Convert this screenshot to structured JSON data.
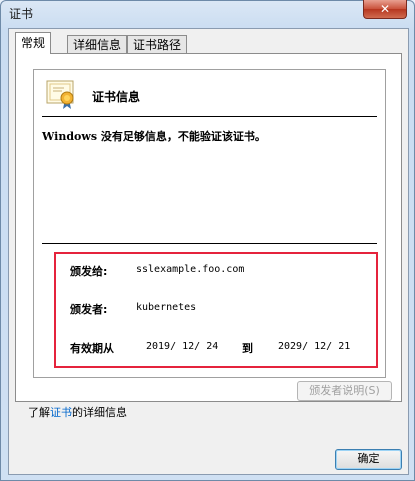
{
  "window": {
    "title": "证书",
    "close_glyph": "✕"
  },
  "tabs": [
    {
      "label": "常规",
      "active": true
    },
    {
      "label": "详细信息",
      "active": false
    },
    {
      "label": "证书路径",
      "active": false
    }
  ],
  "cert": {
    "heading": "证书信息",
    "warning": "Windows 没有足够信息，不能验证该证书。",
    "issued_to_label": "颁发给:",
    "issued_to_value": "sslexample.foo.com",
    "issued_by_label": "颁发者:",
    "issued_by_value": "kubernetes",
    "validity_label": "有效期从",
    "valid_from": "2019/  12/  24",
    "to_label": "到",
    "valid_to": "2029/  12/  21"
  },
  "buttons": {
    "issuer_statement": "颁发者说明(S)",
    "ok": "确定"
  },
  "footer": {
    "prefix": "了解",
    "link": "证书",
    "suffix": "的详细信息"
  },
  "colors": {
    "highlight_border": "#e5233c",
    "link": "#0066cc"
  },
  "icons": {
    "certificate": "certificate-icon"
  }
}
